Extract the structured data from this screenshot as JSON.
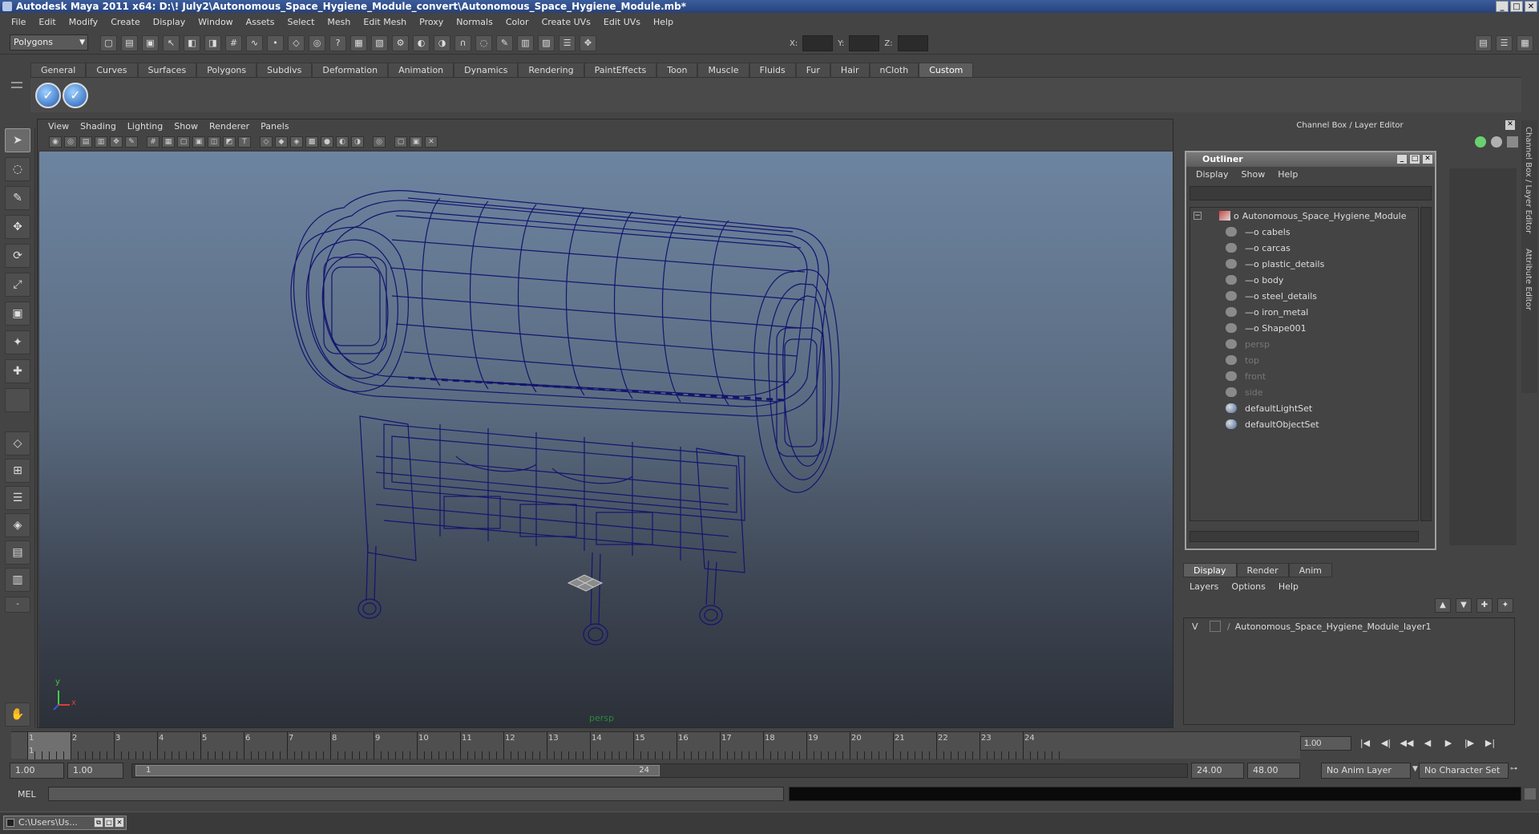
{
  "window": {
    "title": "Autodesk Maya 2011 x64: D:\\! July2\\Autonomous_Space_Hygiene_Module_convert\\Autonomous_Space_Hygiene_Module.mb*",
    "controls": [
      "_",
      "□",
      "✕"
    ]
  },
  "menubar": [
    "File",
    "Edit",
    "Modify",
    "Create",
    "Display",
    "Window",
    "Assets",
    "Select",
    "Mesh",
    "Edit Mesh",
    "Proxy",
    "Normals",
    "Color",
    "Create UVs",
    "Edit UVs",
    "Help"
  ],
  "toolbar": {
    "mode": "Polygons",
    "x_label": "X:",
    "y_label": "Y:",
    "z_label": "Z:"
  },
  "shelf": {
    "tabs": [
      "General",
      "Curves",
      "Surfaces",
      "Polygons",
      "Subdivs",
      "Deformation",
      "Animation",
      "Dynamics",
      "Rendering",
      "PaintEffects",
      "Toon",
      "Muscle",
      "Fluids",
      "Fur",
      "Hair",
      "nCloth",
      "Custom"
    ],
    "active_tab": "Custom"
  },
  "viewport": {
    "menu": [
      "View",
      "Shading",
      "Lighting",
      "Show",
      "Renderer",
      "Panels"
    ],
    "camera_label": "persp",
    "axis_y": "y",
    "axis_x": "x",
    "wire_color": "#14146e"
  },
  "channel_box": {
    "header": "Channel Box / Layer Editor",
    "side_tabs": [
      "Channel Box / Layer Editor",
      "Attribute Editor"
    ]
  },
  "outliner": {
    "title": "Outliner",
    "menu": [
      "Display",
      "Show",
      "Help"
    ],
    "root": "Autonomous_Space_Hygiene_Module",
    "children": [
      "cabels",
      "carcas",
      "plastic_details",
      "body",
      "steel_details",
      "iron_metal",
      "Shape001"
    ],
    "cameras": [
      "persp",
      "top",
      "front",
      "side"
    ],
    "sets": [
      "defaultLightSet",
      "defaultObjectSet"
    ]
  },
  "layer_editor": {
    "tabs": [
      "Display",
      "Render",
      "Anim"
    ],
    "active_tab": "Display",
    "menu": [
      "Layers",
      "Options",
      "Help"
    ],
    "layers": [
      {
        "visible": "V",
        "name": "Autonomous_Space_Hygiene_Module_layer1"
      }
    ]
  },
  "timeline": {
    "ticks": [
      "1",
      "2",
      "3",
      "4",
      "5",
      "6",
      "7",
      "8",
      "9",
      "10",
      "11",
      "12",
      "13",
      "14",
      "15",
      "16",
      "17",
      "18",
      "19",
      "20",
      "21",
      "22",
      "23",
      "24"
    ],
    "current_frame_display": "1",
    "current_time": "1.00"
  },
  "range": {
    "start": "1.00",
    "playback_start": "1.00",
    "slider_start": "1",
    "slider_end": "24",
    "playback_end": "24.00",
    "end": "48.00",
    "anim_layer": "No Anim Layer",
    "character_set": "No Character Set"
  },
  "command_line": {
    "label": "MEL"
  },
  "taskbar": {
    "item": "C:\\Users\\Us..."
  }
}
